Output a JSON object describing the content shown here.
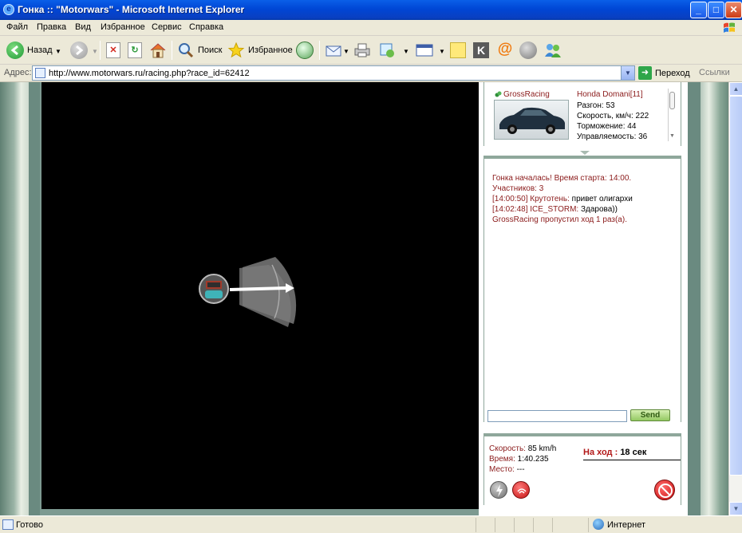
{
  "window": {
    "title": "Гонка :: \"Motorwars\" - Microsoft Internet Explorer",
    "controls": {
      "minimize": "_",
      "maximize": "□",
      "close": "✕"
    }
  },
  "menu": [
    "Файл",
    "Правка",
    "Вид",
    "Избранное",
    "Сервис",
    "Справка"
  ],
  "toolbar": {
    "back_label": "Назад",
    "search_label": "Поиск",
    "favorites_label": "Избранное"
  },
  "address": {
    "label": "Адрес:",
    "url": "http://www.motorwars.ru/racing.php?race_id=62412",
    "go_label": "Переход",
    "links_label": "Ссылки"
  },
  "car": {
    "owner": "GrossRacing",
    "model": "Honda Domani[11]",
    "stats": [
      {
        "text": "Разгон: 53"
      },
      {
        "text": "Скорость, км/ч: 222"
      },
      {
        "text": "Торможение: 44"
      },
      {
        "text": "Управляемость: 36"
      }
    ]
  },
  "chat": {
    "lines": [
      {
        "kind": "sys",
        "text": "Гонка началась! Время старта: 14:00."
      },
      {
        "kind": "sys",
        "text": "Участников: 3"
      },
      {
        "kind": "msg",
        "name": "[14:00:50] Крутотень:",
        "text": " привет олигархи"
      },
      {
        "kind": "msg",
        "name": "[14:02:48] ICE_STORM:",
        "text": " Здарова))"
      },
      {
        "kind": "sys",
        "text": "GrossRacing пропустил ход 1 раз(а)."
      }
    ],
    "input_value": "",
    "send_label": "Send"
  },
  "race_status": {
    "speed_label": "Скорость:",
    "speed_value": "85 km/h",
    "time_label": "Время:",
    "time_value": "1:40.235",
    "place_label": "Место:",
    "place_value": "---",
    "turn_label": "На ход :",
    "turn_value": "18 сек"
  },
  "statusbar": {
    "left_text": "Готово",
    "zone_text": "Интернет"
  },
  "colors": {
    "accent_red": "#8b1b1b",
    "panel_border": "#8fa79b",
    "send_green": "#94c962"
  }
}
